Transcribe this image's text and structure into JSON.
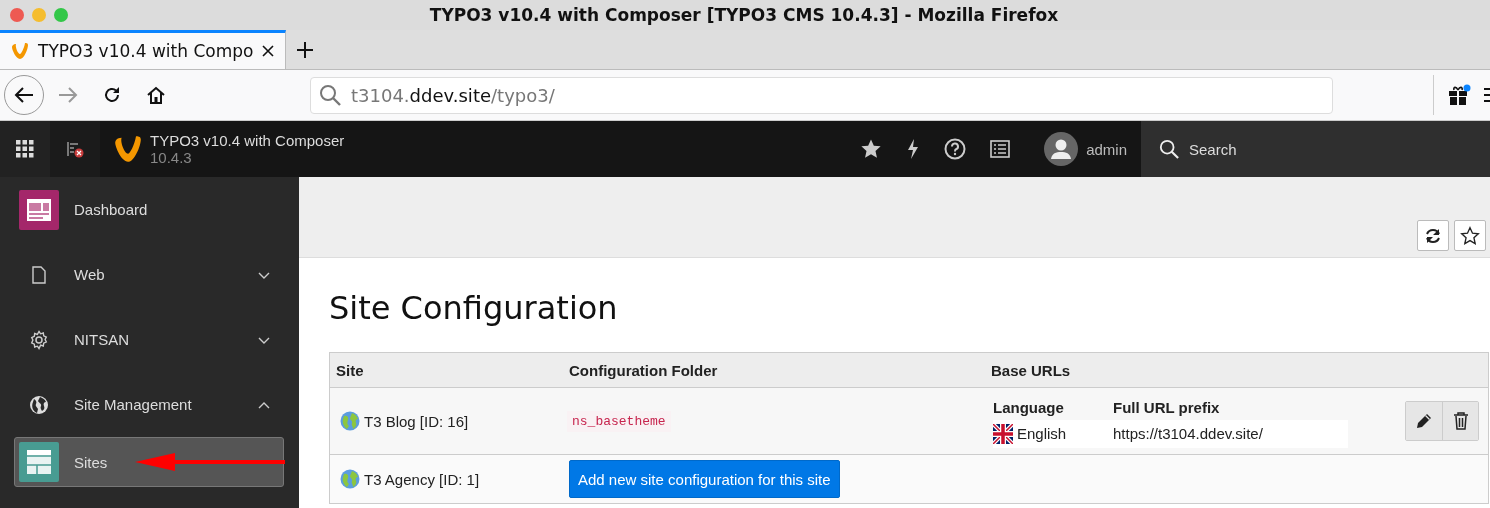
{
  "window": {
    "title": "TYPO3 v10.4 with Composer [TYPO3 CMS 10.4.3] - Mozilla Firefox"
  },
  "browser": {
    "tabs": [
      {
        "label": "TYPO3 v10.4 with Compo",
        "selected": true
      }
    ],
    "url": {
      "host_prefix": "t3104.",
      "domain": "ddev.site",
      "path": "/typo3/"
    },
    "extension_badge": true
  },
  "topbar": {
    "site_name": "TYPO3 v10.4 with Composer",
    "version": "10.4.3",
    "user": "admin",
    "search_placeholder": "Search"
  },
  "sidebar": {
    "items": [
      {
        "kind": "link",
        "label": "Dashboard"
      },
      {
        "kind": "group",
        "label": "Web",
        "expanded": false
      },
      {
        "kind": "group",
        "label": "NITSAN",
        "expanded": false
      },
      {
        "kind": "group",
        "label": "Site Management",
        "expanded": true,
        "children": [
          {
            "label": "Sites",
            "selected": true
          }
        ]
      }
    ]
  },
  "page": {
    "title": "Site Configuration",
    "table": {
      "columns": [
        "Site",
        "Configuration Folder",
        "Base URLs"
      ],
      "rows": [
        {
          "site": "T3 Blog [ID: 16]",
          "folder": "ns_basetheme",
          "base_urls": {
            "columns": [
              "Language",
              "Full URL prefix"
            ],
            "rows": [
              {
                "language": "English",
                "url": "https://t3104.ddev.site/"
              }
            ]
          },
          "actions": true
        },
        {
          "site": "T3 Agency [ID: 1]",
          "add_button": "Add new site configuration for this site",
          "actions": false
        }
      ]
    }
  }
}
